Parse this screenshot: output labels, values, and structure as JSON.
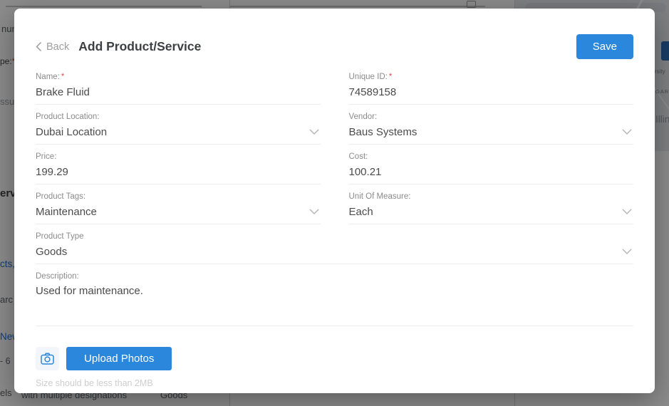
{
  "modal": {
    "back_label": "Back",
    "title": "Add Product/Service",
    "save_label": "Save",
    "required_marker": "*",
    "fields": {
      "name": {
        "label": "Name:",
        "value": "Brake Fluid"
      },
      "unique_id": {
        "label": "Unique ID:",
        "value": "74589158"
      },
      "product_location": {
        "label": "Product Location:",
        "value": "Dubai Location"
      },
      "vendor": {
        "label": "Vendor:",
        "value": "Baus Systems"
      },
      "price": {
        "label": "Price:",
        "value": "199.29"
      },
      "cost": {
        "label": "Cost:",
        "value": "100.21"
      },
      "product_tags": {
        "label": "Product Tags:",
        "value": "Maintenance"
      },
      "unit_of_measure": {
        "label": "Unit Of Measure:",
        "value": "Each"
      },
      "product_type": {
        "label": "Product Type",
        "value": "Goods"
      },
      "description": {
        "label": "Description:",
        "value": "Used for maintenance."
      }
    },
    "upload": {
      "button_label": "Upload Photos",
      "hint": "Size should be less than 2MB"
    },
    "icons": {
      "back": "chevron-left",
      "dropdown": "chevron-down",
      "camera": "camera"
    }
  },
  "background": {
    "left_fragments": {
      "f1": "nur",
      "f2": "pe:",
      "f2_req": "*",
      "f3": "ssue",
      "f4": "ervi",
      "f5": "cts,",
      "f6": "arc",
      "f7": "New",
      "f8": "- 6",
      "f9": "els"
    },
    "right_map_fragments": {
      "r1": "rsity",
      "r2": "GARD",
      "r3": "Illinc"
    },
    "bottom_fragments": {
      "b1": "with multiple designations",
      "b2": "Goods"
    }
  },
  "colors": {
    "accent_blue": "#2b87db",
    "link_blue": "#1a73e8",
    "required_red": "#e05252"
  }
}
